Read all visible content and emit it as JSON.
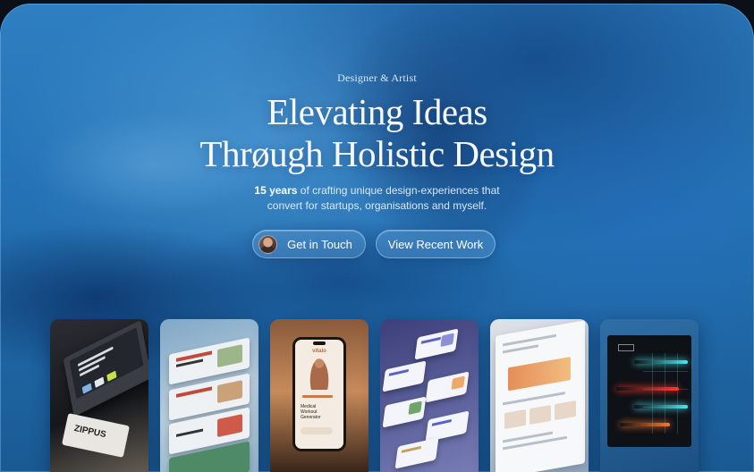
{
  "hero": {
    "eyebrow": "Designer & Artist",
    "headline_line1": "Elevating Ideas",
    "headline_line2": "Thrøugh Holistic Design",
    "sub_strong": "15 years",
    "sub_line1_rest": " of crafting unique design-experiences that",
    "sub_line2": "convert for startups, organisations and myself."
  },
  "buttons": {
    "contact_label": "Get in Touch",
    "work_label": "View Recent Work"
  },
  "cards": {
    "card1_paper_text": "ZIPPUS",
    "card3_brand": "vitalo",
    "card3_title": "Medical Workout Generator"
  },
  "colors": {
    "background": "#2472b5",
    "button_fill": "rgba(120,180,235,0.28)",
    "text": "#f5f9ff"
  }
}
